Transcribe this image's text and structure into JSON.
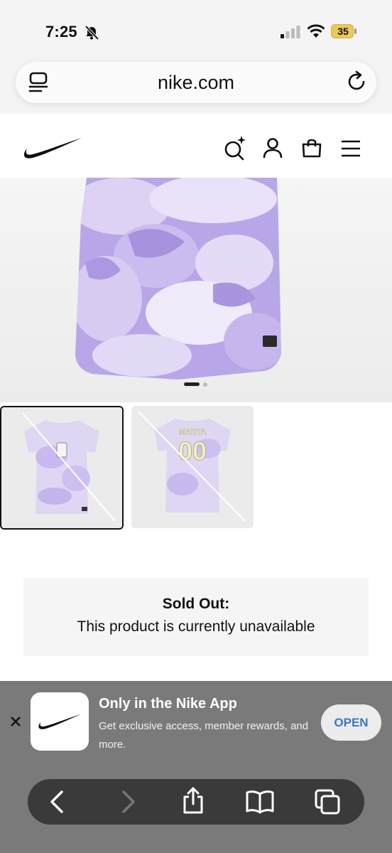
{
  "status_bar": {
    "time": "7:25",
    "battery": "35"
  },
  "browser": {
    "url": "nike.com"
  },
  "sold_out": {
    "title": "Sold Out:",
    "message": "This product is currently unavailable"
  },
  "app_banner": {
    "title": "Only in the Nike App",
    "description": "Get exclusive access, member rewards, and more.",
    "open_label": "OPEN"
  },
  "jersey_back": {
    "name_text": "MARTA",
    "number_text": "00"
  },
  "colors": {
    "jersey_lavender": "#b9a6e8",
    "jersey_light": "#e9e2f8",
    "banner_bg": "#7a7a7a",
    "open_text": "#3b78c7"
  },
  "icons": [
    "mute-bell-icon",
    "signal-icon",
    "wifi-icon",
    "battery-icon",
    "reader-icon",
    "reload-icon",
    "nike-swoosh-icon",
    "search-ai-icon",
    "account-icon",
    "bag-icon",
    "menu-icon",
    "close-icon",
    "back-icon",
    "forward-icon",
    "share-icon",
    "bookmarks-icon",
    "tabs-icon"
  ]
}
